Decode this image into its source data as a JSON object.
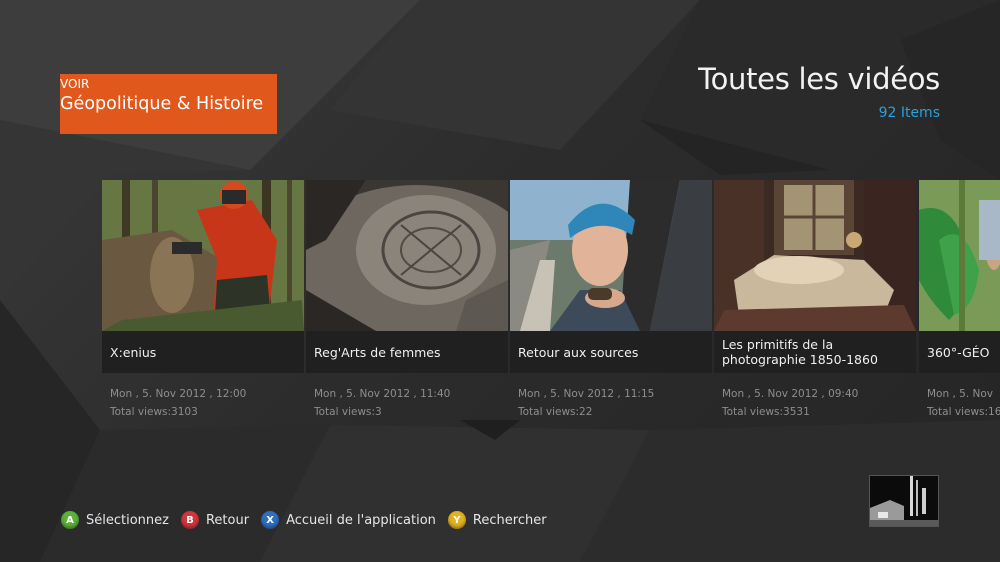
{
  "category": {
    "kicker": "VOIR",
    "title": "Géopolitique & Histoire",
    "color": "#e0581c"
  },
  "header": {
    "title": "Toutes les vidéos",
    "count": "92 Items",
    "count_color": "#2aa0d8"
  },
  "videos": [
    {
      "title": "X:enius",
      "date": "Mon , 5. Nov 2012 , 12:00",
      "views": "Total views:3103"
    },
    {
      "title": "Reg'Arts de femmes",
      "date": "Mon , 5. Nov 2012 , 11:40",
      "views": "Total views:3"
    },
    {
      "title": "Retour aux sources",
      "date": "Mon , 5. Nov 2012 , 11:15",
      "views": "Total views:22"
    },
    {
      "title": "Les primitifs de la photographie 1850-1860",
      "date": "Mon , 5. Nov 2012 , 09:40",
      "views": "Total views:3531"
    },
    {
      "title": "360°-GÉO",
      "date": "Mon , 5. Nov",
      "views": "Total views:16"
    }
  ],
  "hints": [
    {
      "button": "A",
      "label": "Sélectionnez",
      "color": "#5bb23a"
    },
    {
      "button": "B",
      "label": "Retour",
      "color": "#d2363a"
    },
    {
      "button": "X",
      "label": "Accueil de l'application",
      "color": "#2f6fc0"
    },
    {
      "button": "Y",
      "label": "Rechercher",
      "color": "#e2b21f"
    }
  ]
}
